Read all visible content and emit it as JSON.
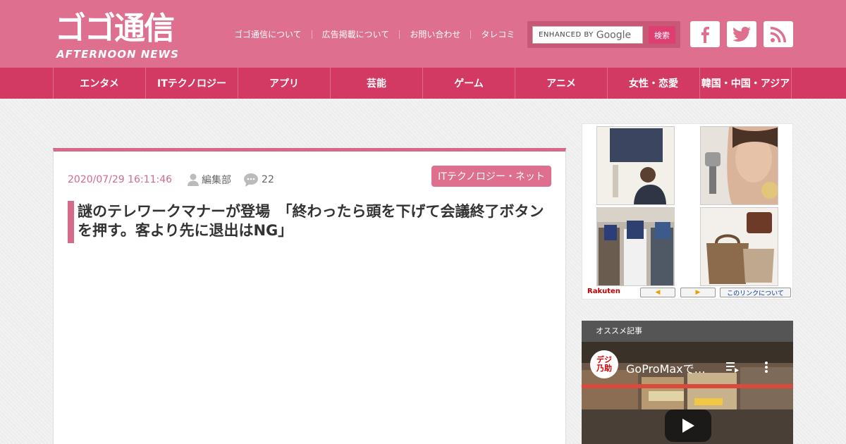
{
  "header": {
    "logo_main": "ゴゴ通信",
    "logo_sub": "AFTERNOON NEWS",
    "topnav": [
      "ゴゴ通信について",
      "広告掲載について",
      "お問い合わせ",
      "タレコミ"
    ],
    "search": {
      "enhanced_label": "ENHANCED BY",
      "google_label": "Google",
      "button_label": "検索"
    },
    "social": [
      "facebook-icon",
      "twitter-icon",
      "rss-icon"
    ],
    "colors": {
      "header_bg": "#de6f8f",
      "nav_bg": "#d23a63"
    }
  },
  "catnav": {
    "items": [
      "エンタメ",
      "ITテクノロジー",
      "アプリ",
      "芸能",
      "ゲーム",
      "アニメ",
      "女性・恋愛",
      "韓国・中国・アジア"
    ]
  },
  "article": {
    "date": "2020/07/29 16:11:46",
    "author": "編集部",
    "comments": "22",
    "category": "ITテクノロジー・ネット",
    "title": "謎のテレワークマナーが登場　「終わったら頭を下げて会議終了ボタンを押す。客より先に退出はNG」"
  },
  "ad": {
    "rakuten_label": "Rakuten",
    "prev_label": "◀",
    "next_label": "▶",
    "about_label": "このリンクについて"
  },
  "recommend": {
    "heading": "オススメ記事",
    "video_title": "GoProMaxで…",
    "channel_badge": [
      "デジ",
      "乃助"
    ]
  }
}
